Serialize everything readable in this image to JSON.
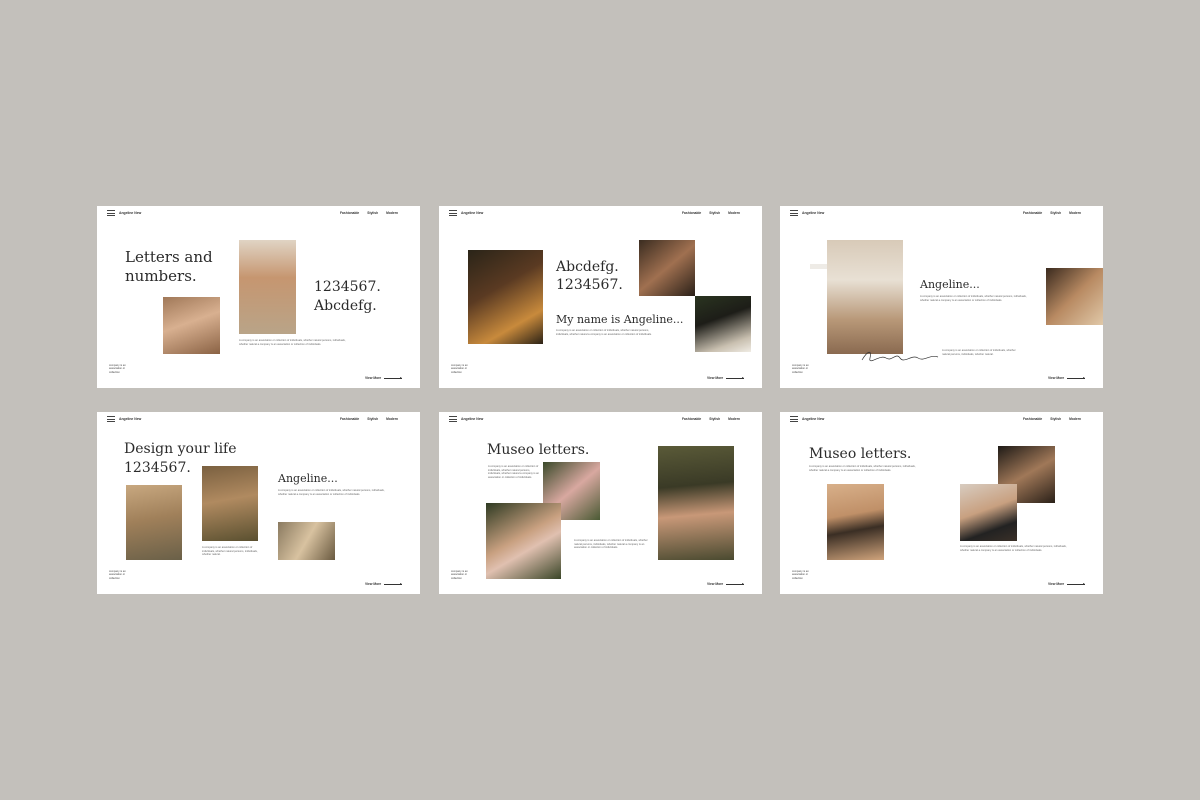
{
  "common": {
    "brand": "Angeline New",
    "nav": [
      "Fashionable",
      "Stylish",
      "Modern"
    ],
    "footnote": "company is an association or collection",
    "view_more": "View More"
  },
  "slides": [
    {
      "heading": "Letters and\nnumbers.",
      "numbers": "1234567.\nAbcdefg.",
      "para": "A company is an association or collection of individuals, whether natural persons, individuals, whether natural a company is an association or collection of individuals."
    },
    {
      "heading": "Abcdefg.\n1234567.",
      "subheading": "My name is Angeline...",
      "para": "A company is an association or collection of individuals, whether natural persons, individuals, whether natural a company is an association or collection of individuals."
    },
    {
      "heading": "Angeline...",
      "para": "A company is an association or collection of individuals, whether natural persons, individuals, whether natural a company is an association or collection of individuals.",
      "para2": "A company is an association or collection of individuals, whether natural persons, individuals, whether natural."
    },
    {
      "heading": "Design your life\n1234567.",
      "subheading": "Angeline...",
      "para": "A company is an association or collection of individuals, whether natural persons, individuals, whether natural a company is an association or collection of individuals.",
      "para2": "A company is an association or collection of individuals, whether natural persons, individuals, whether natural."
    },
    {
      "heading": "Museo letters.",
      "para": "A company is an association or collection of individuals, whether natural persons, individuals, whether natural a company is an association or collection of individuals.",
      "para2": "A company is an association or collection of individuals, whether natural persons, individuals, whether natural a company is an association or collection of individuals."
    },
    {
      "heading": "Museo letters.",
      "para": "A company is an association or collection of individuals, whether natural persons, individuals, whether natural a company is an association or collection of individuals.",
      "para2": "A company is an association or collection of individuals, whether natural persons, individuals, whether natural a company is an association or collection of individuals."
    }
  ],
  "colors": {
    "background": "#c3c0bb",
    "slide": "#ffffff",
    "text": "#2b2b2b",
    "photo_tones": [
      "#c49a7a",
      "#8a6a4e",
      "#3b2a1e",
      "#2f3a24",
      "#d8c6b0",
      "#b68b5e"
    ]
  }
}
